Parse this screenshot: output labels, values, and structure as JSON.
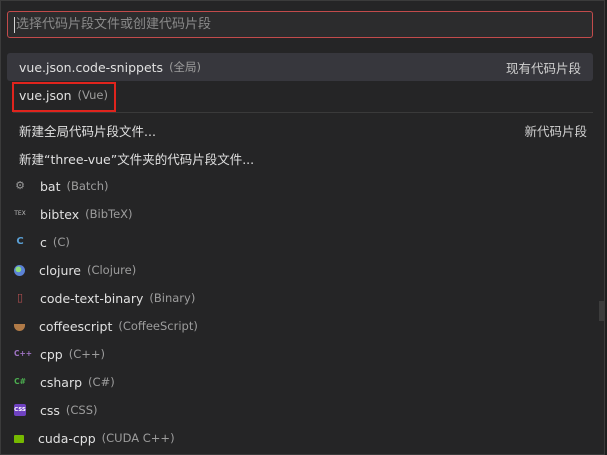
{
  "search": {
    "placeholder": "选择代码片段文件或创建代码片段",
    "value": ""
  },
  "existing": [
    {
      "label": "vue.json.code-snippets",
      "desc": "(全局)",
      "right": "现有代码片段",
      "selected": true
    },
    {
      "label": "vue.json",
      "desc": "(Vue)",
      "right": ""
    }
  ],
  "create": [
    {
      "label": "新建全局代码片段文件...",
      "right": "新代码片段"
    },
    {
      "label": "新建“three-vue”文件夹的代码片段文件...",
      "right": ""
    }
  ],
  "languages": [
    {
      "label": "bat",
      "desc": "(Batch)",
      "icon": "gear-icon"
    },
    {
      "label": "bibtex",
      "desc": "(BibTeX)",
      "icon": "tex-icon"
    },
    {
      "label": "c",
      "desc": "(C)",
      "icon": "c-icon"
    },
    {
      "label": "clojure",
      "desc": "(Clojure)",
      "icon": "clojure-icon"
    },
    {
      "label": "code-text-binary",
      "desc": "(Binary)",
      "icon": "binary-file-icon"
    },
    {
      "label": "coffeescript",
      "desc": "(CoffeeScript)",
      "icon": "coffee-icon"
    },
    {
      "label": "cpp",
      "desc": "(C++)",
      "icon": "cpp-icon"
    },
    {
      "label": "csharp",
      "desc": "(C#)",
      "icon": "csharp-icon"
    },
    {
      "label": "css",
      "desc": "(CSS)",
      "icon": "css-icon"
    },
    {
      "label": "cuda-cpp",
      "desc": "(CUDA C++)",
      "icon": "cuda-icon"
    }
  ],
  "icon_glyphs": {
    "tex": "TEX",
    "c": "C",
    "binary": "▯",
    "cpp": "C++",
    "csharp": "C#",
    "css": "CSS"
  },
  "colors": {
    "highlight_border": "#e0241d",
    "search_border": "#c24b4b",
    "selected_row": "#37373d"
  }
}
